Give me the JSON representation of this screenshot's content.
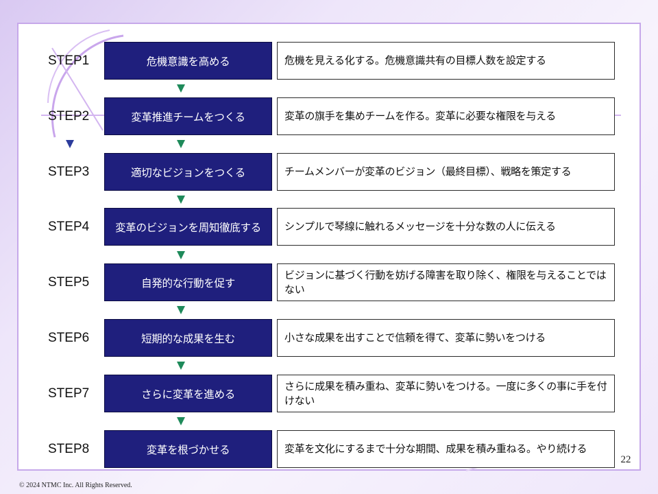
{
  "steps": [
    {
      "label": "STEP1",
      "title": "危機意識を高める",
      "description": "危機を見える化する。危機意識共有の目標人数を設定する"
    },
    {
      "label": "STEP2",
      "title": "変革推進チームをつくる",
      "description": "変革の旗手を集めチームを作る。変革に必要な権限を与える"
    },
    {
      "label": "STEP3",
      "title": "適切なビジョンをつくる",
      "description": "チームメンバーが変革のビジョン（最終目標）、戦略を策定する"
    },
    {
      "label": "STEP4",
      "title": "変革のビジョンを周知徹底する",
      "description": "シンプルで琴線に触れるメッセージを十分な数の人に伝える"
    },
    {
      "label": "STEP5",
      "title": "自発的な行動を促す",
      "description": "ビジョンに基づく行動を妨げる障害を取り除く、権限を与えることではない"
    },
    {
      "label": "STEP6",
      "title": "短期的な成果を生む",
      "description": "小さな成果を出すことで信頼を得て、変革に勢いをつける"
    },
    {
      "label": "STEP7",
      "title": "さらに変革を進める",
      "description": "さらに成果を積み重ね、変革に勢いをつける。一度に多くの事に手を付けない"
    },
    {
      "label": "STEP8",
      "title": "変革を根づかせる",
      "description": "変革を文化にするまで十分な期間、成果を積み重ねる。やり続ける"
    }
  ],
  "footer": {
    "page_number": "22",
    "copyright": "© 2024 NTMC Inc. All Rights Reserved."
  },
  "colors": {
    "step_box": "#1f1f7d",
    "arrow": "#1e8a5a",
    "frame": "#c6a8ea"
  }
}
